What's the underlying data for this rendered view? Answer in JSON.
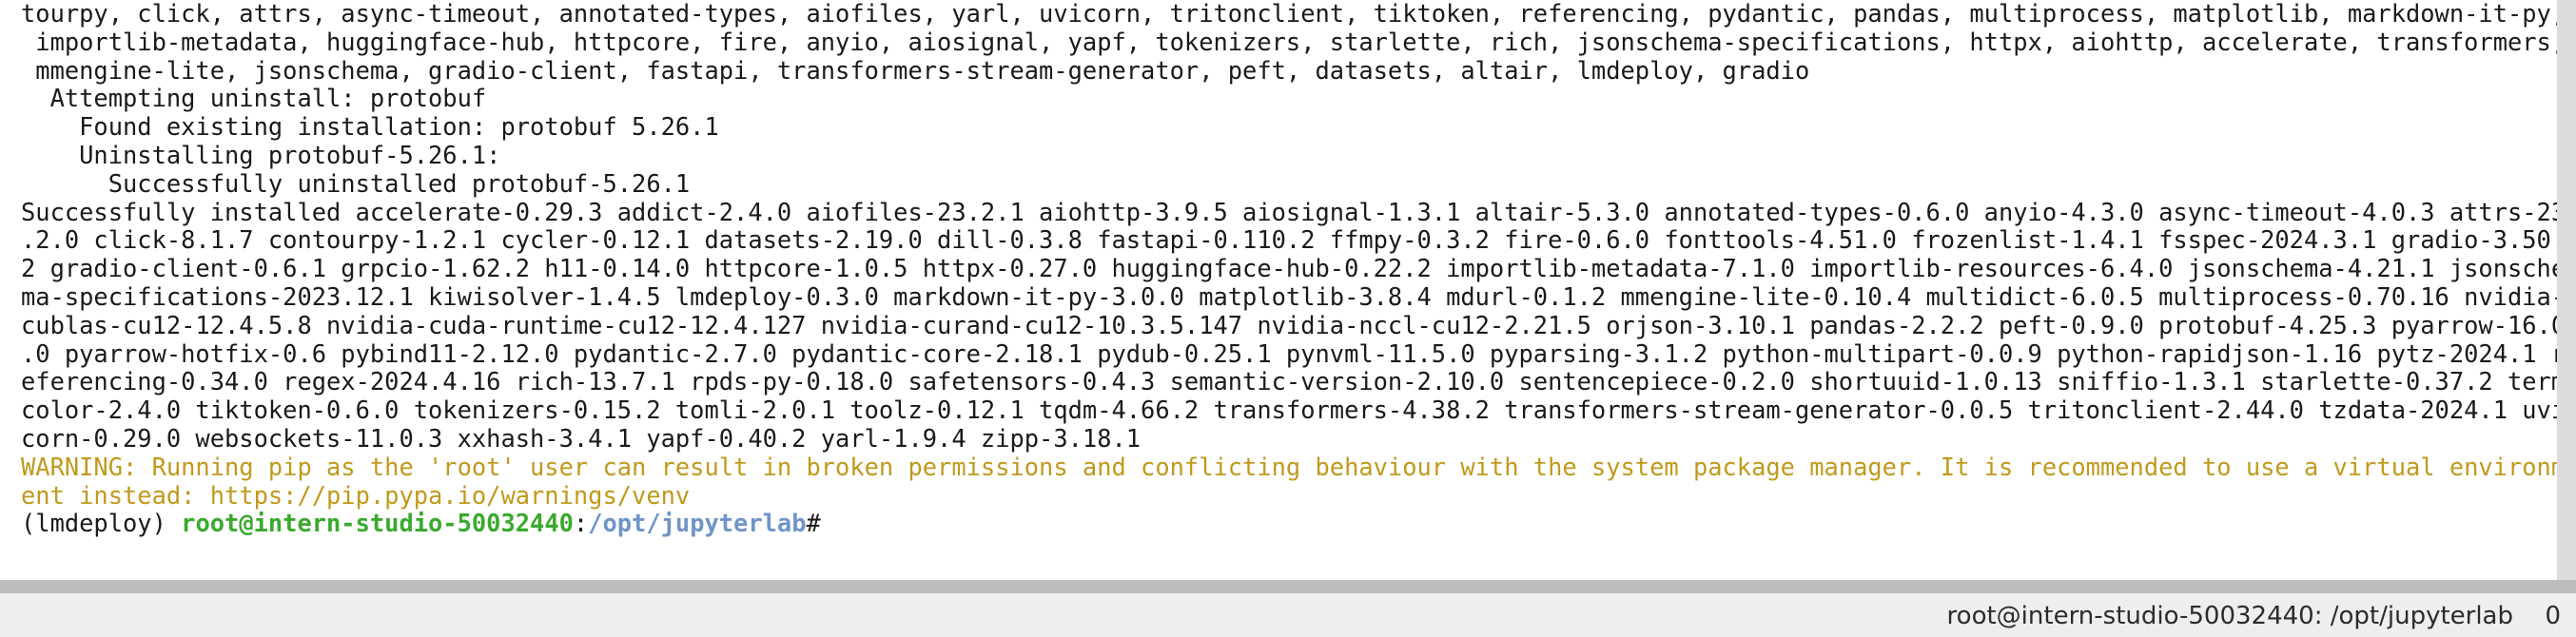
{
  "terminal": {
    "lines": [
      {
        "text": "tourpy, click, attrs, async-timeout, annotated-types, aiofiles, yarl, uvicorn, tritonclient, tiktoken, referencing, pydantic, pandas, multiprocess, matplotlib, markdown-it-py,"
      },
      {
        "text": " importlib-metadata, huggingface-hub, httpcore, fire, anyio, aiosignal, yapf, tokenizers, starlette, rich, jsonschema-specifications, httpx, aiohttp, accelerate, transformers,"
      },
      {
        "text": " mmengine-lite, jsonschema, gradio-client, fastapi, transformers-stream-generator, peft, datasets, altair, lmdeploy, gradio"
      },
      {
        "text": "  Attempting uninstall: protobuf"
      },
      {
        "text": "    Found existing installation: protobuf 5.26.1"
      },
      {
        "text": "    Uninstalling protobuf-5.26.1:"
      },
      {
        "text": "      Successfully uninstalled protobuf-5.26.1"
      },
      {
        "text": "Successfully installed accelerate-0.29.3 addict-2.4.0 aiofiles-23.2.1 aiohttp-3.9.5 aiosignal-1.3.1 altair-5.3.0 annotated-types-0.6.0 anyio-4.3.0 async-timeout-4.0.3 attrs-23"
      },
      {
        "text": ".2.0 click-8.1.7 contourpy-1.2.1 cycler-0.12.1 datasets-2.19.0 dill-0.3.8 fastapi-0.110.2 ffmpy-0.3.2 fire-0.6.0 fonttools-4.51.0 frozenlist-1.4.1 fsspec-2024.3.1 gradio-3.50."
      },
      {
        "text": "2 gradio-client-0.6.1 grpcio-1.62.2 h11-0.14.0 httpcore-1.0.5 httpx-0.27.0 huggingface-hub-0.22.2 importlib-metadata-7.1.0 importlib-resources-6.4.0 jsonschema-4.21.1 jsonsche"
      },
      {
        "text": "ma-specifications-2023.12.1 kiwisolver-1.4.5 lmdeploy-0.3.0 markdown-it-py-3.0.0 matplotlib-3.8.4 mdurl-0.1.2 mmengine-lite-0.10.4 multidict-6.0.5 multiprocess-0.70.16 nvidia-"
      },
      {
        "text": "cublas-cu12-12.4.5.8 nvidia-cuda-runtime-cu12-12.4.127 nvidia-curand-cu12-10.3.5.147 nvidia-nccl-cu12-2.21.5 orjson-3.10.1 pandas-2.2.2 peft-0.9.0 protobuf-4.25.3 pyarrow-16.0"
      },
      {
        "text": ".0 pyarrow-hotfix-0.6 pybind11-2.12.0 pydantic-2.7.0 pydantic-core-2.18.1 pydub-0.25.1 pynvml-11.5.0 pyparsing-3.1.2 python-multipart-0.0.9 python-rapidjson-1.16 pytz-2024.1 r"
      },
      {
        "text": "eferencing-0.34.0 regex-2024.4.16 rich-13.7.1 rpds-py-0.18.0 safetensors-0.4.3 semantic-version-2.10.0 sentencepiece-0.2.0 shortuuid-1.0.13 sniffio-1.3.1 starlette-0.37.2 term"
      },
      {
        "text": "color-2.4.0 tiktoken-0.6.0 tokenizers-0.15.2 tomli-2.0.1 toolz-0.12.1 tqdm-4.66.2 transformers-4.38.2 transformers-stream-generator-0.0.5 tritonclient-2.44.0 tzdata-2024.1 uvi"
      },
      {
        "text": "corn-0.29.0 websockets-11.0.3 xxhash-3.4.1 yapf-0.40.2 yarl-1.9.4 zipp-3.18.1"
      }
    ],
    "warning_lines": [
      {
        "text": "WARNING: Running pip as the 'root' user can result in broken permissions and conflicting behaviour with the system package manager. It is recommended to use a virtual environm"
      },
      {
        "text": "ent instead: https://pip.pypa.io/warnings/venv"
      }
    ],
    "prompt": {
      "env": "(lmdeploy) ",
      "user_host": "root@intern-studio-50032440",
      "separator": ":",
      "path": "/opt/jupyterlab",
      "symbol": "#"
    },
    "colors": {
      "text": "#1a1a1a",
      "warning": "#c09a1c",
      "user_host": "#3aaa2e",
      "path": "#6f94c8"
    }
  },
  "status_bar": {
    "path_text": "root@intern-studio-50032440: /opt/jupyterlab",
    "count": "0"
  }
}
